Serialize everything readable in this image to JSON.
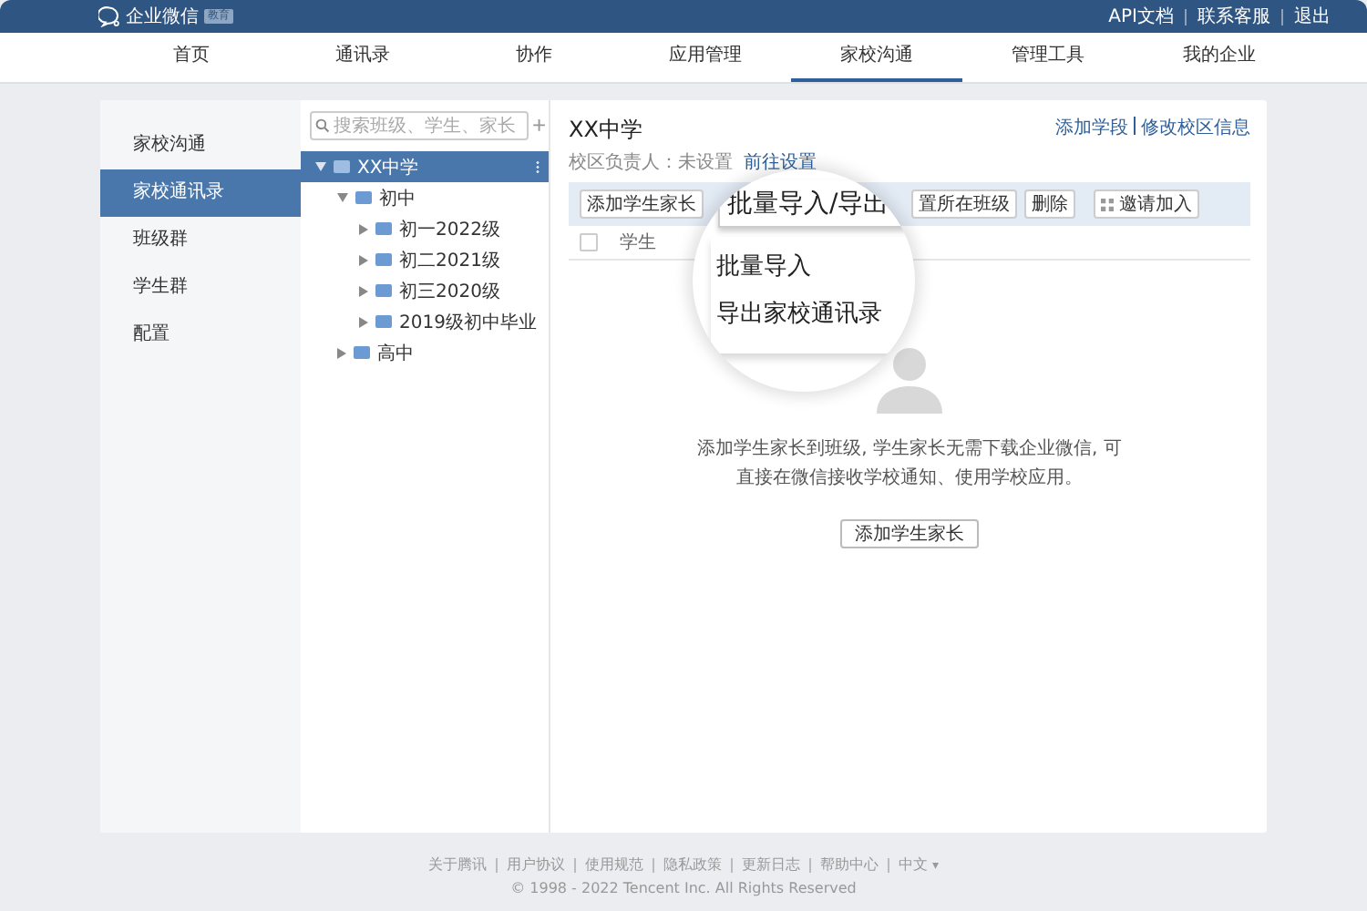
{
  "header": {
    "logo_text": "企业微信",
    "badge": "教育",
    "links": [
      "API文档",
      "联系客服",
      "退出"
    ]
  },
  "nav": [
    {
      "label": "首页",
      "selected": false
    },
    {
      "label": "通讯录",
      "selected": false
    },
    {
      "label": "协作",
      "selected": false
    },
    {
      "label": "应用管理",
      "selected": false
    },
    {
      "label": "家校沟通",
      "selected": true
    },
    {
      "label": "管理工具",
      "selected": false
    },
    {
      "label": "我的企业",
      "selected": false
    }
  ],
  "sidebar": {
    "items": [
      {
        "label": "家校沟通",
        "selected": false
      },
      {
        "label": "家校通讯录",
        "selected": true
      },
      {
        "label": "班级群",
        "selected": false
      },
      {
        "label": "学生群",
        "selected": false
      },
      {
        "label": "配置",
        "selected": false
      }
    ]
  },
  "tree": {
    "search": {
      "placeholder": "搜索班级、学生、家长"
    },
    "add": "+",
    "nodes": [
      {
        "label": "XX中学",
        "expanded": true,
        "selected": true,
        "children": [
          {
            "label": "初中",
            "expanded": true,
            "selected": false,
            "children": [
              {
                "label": "初一2022级",
                "expanded": false,
                "selected": false
              },
              {
                "label": "初二2021级",
                "expanded": false,
                "selected": false
              },
              {
                "label": "初三2020级",
                "expanded": false,
                "selected": false
              },
              {
                "label": "2019级初中毕业",
                "expanded": false,
                "selected": false
              }
            ]
          },
          {
            "label": "高中",
            "expanded": false,
            "selected": false
          }
        ]
      }
    ]
  },
  "main": {
    "title": "XX中学",
    "manager": "校区负责人：未设置",
    "manager_link": "前往设置",
    "top_links": [
      "添加学段",
      "修改校区信息"
    ],
    "toolbar": [
      {
        "label": "添加学生家长",
        "kind": "plain"
      },
      {
        "label": "置所在班级",
        "kind": "plain"
      },
      {
        "label": "删除",
        "kind": "plain"
      },
      {
        "label": "邀请加入",
        "kind": "grid"
      }
    ],
    "select_all": {
      "checked": false
    },
    "columns": [
      "学生"
    ],
    "empty": {
      "text": "添加学生家长到班级, 学生家长无需下载企业微信, 可直接在微信接收学校通知、使用学校应用。",
      "button": "添加学生家长"
    },
    "magnifier": {
      "button": "批量导入/导出",
      "menu": [
        "批量导入",
        "导出家校通讯录"
      ]
    }
  },
  "footer": {
    "links": [
      "关于腾讯",
      "用户协议",
      "使用规范",
      "隐私政策",
      "更新日志",
      "帮助中心"
    ],
    "language": "中文",
    "language_caret": "▾",
    "copyright": "© 1998 - 2022 Tencent Inc. All Rights Reserved"
  }
}
